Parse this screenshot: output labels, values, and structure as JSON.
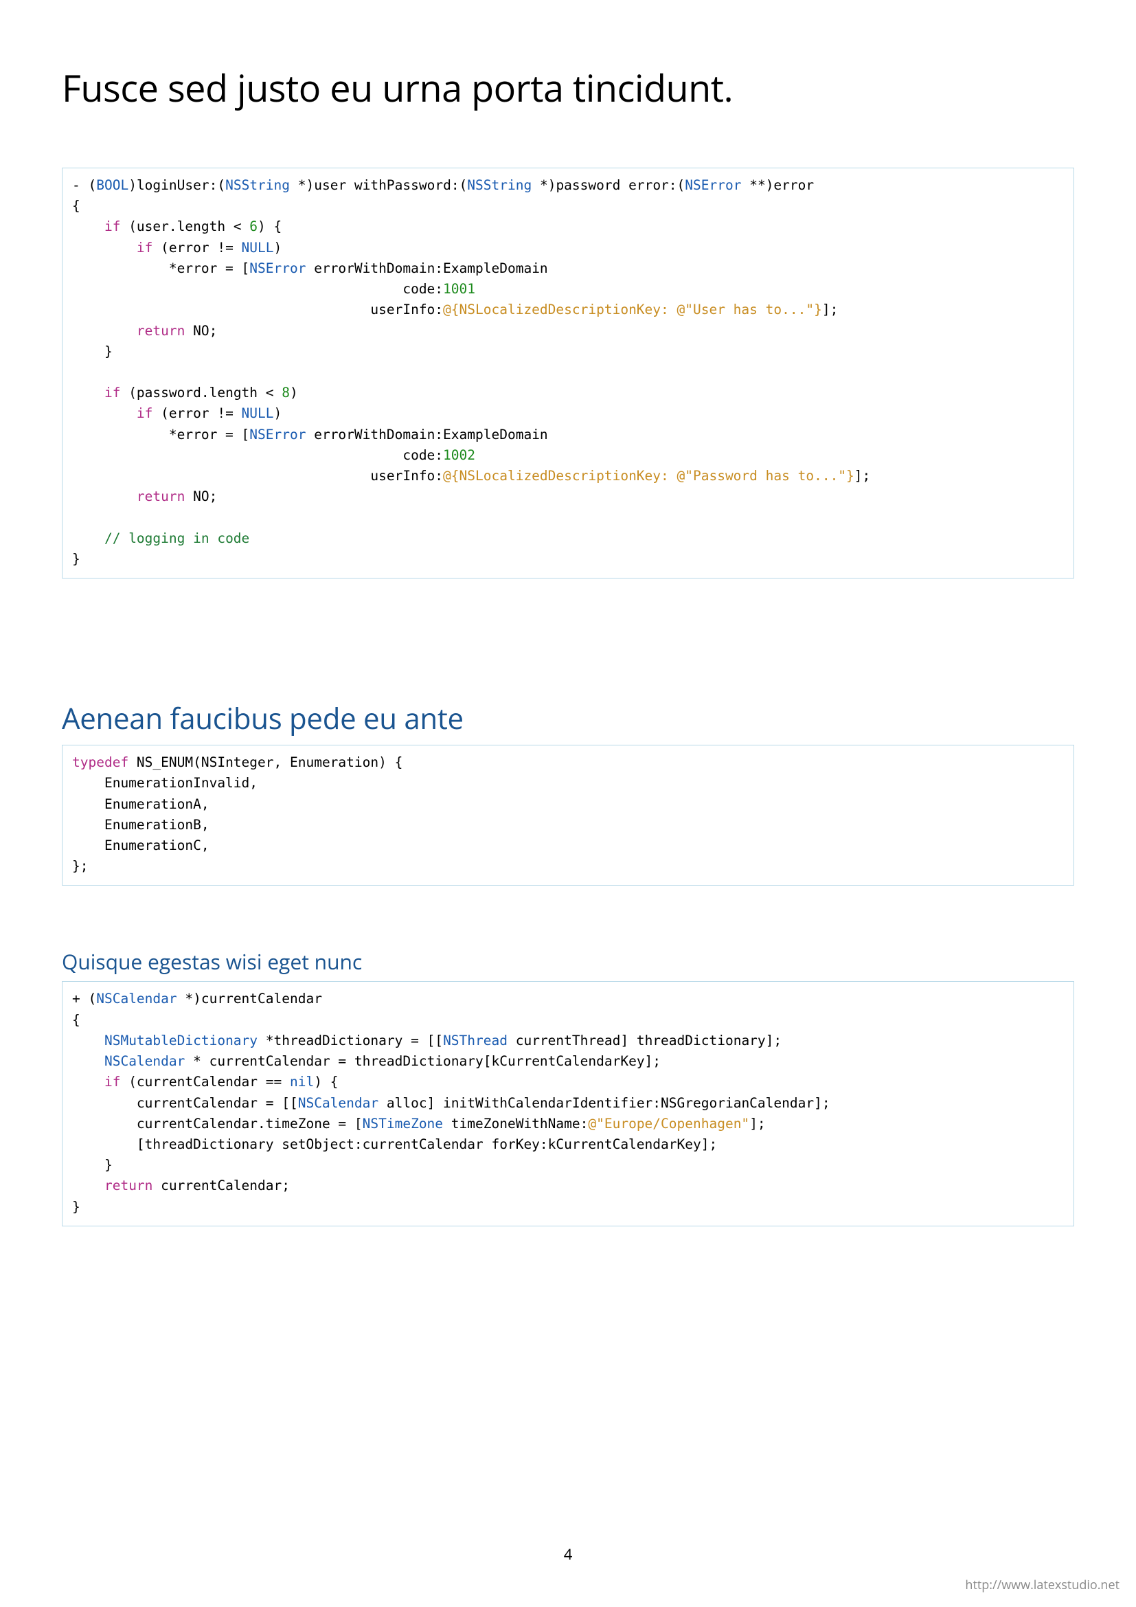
{
  "page_number": "4",
  "footer_url": "http://www.latexstudio.net",
  "heading_main": "Fusce sed justo eu urna porta tincidunt.",
  "heading_section": "Aenean faucibus pede eu ante",
  "heading_subsection": "Quisque egestas wisi eget nunc",
  "code1": {
    "l01a": "- (",
    "l01_bool": "BOOL",
    "l01b": ")loginUser:(",
    "l01_ns1": "NSString",
    "l01c": " *)user withPassword:(",
    "l01_ns2": "NSString",
    "l01d": " *)password error:(",
    "l01_ns3": "NSError",
    "l01e": " **)error",
    "l02": "{",
    "l03a": "    ",
    "l03_if": "if",
    "l03b": " (user.length < ",
    "l03_num": "6",
    "l03c": ") {",
    "l04a": "        ",
    "l04_if": "if",
    "l04b": " (error != ",
    "l04_null": "NULL",
    "l04c": ")",
    "l05a": "            *error = [",
    "l05_nserr": "NSError",
    "l05b": " errorWithDomain:ExampleDomain",
    "l06a": "                                         code:",
    "l06_num": "1001",
    "l07a": "                                     userInfo:",
    "l07_str": "@{NSLocalizedDescriptionKey: @\"User has to...\"}",
    "l07b": "];",
    "l08a": "        ",
    "l08_ret": "return",
    "l08b": " NO;",
    "l09": "    }",
    "blank": "",
    "l11a": "    ",
    "l11_if": "if",
    "l11b": " (password.length < ",
    "l11_num": "8",
    "l11c": ")",
    "l12a": "        ",
    "l12_if": "if",
    "l12b": " (error != ",
    "l12_null": "NULL",
    "l12c": ")",
    "l13a": "            *error = [",
    "l13_nserr": "NSError",
    "l13b": " errorWithDomain:ExampleDomain",
    "l14a": "                                         code:",
    "l14_num": "1002",
    "l15a": "                                     userInfo:",
    "l15_str": "@{NSLocalizedDescriptionKey: @\"Password has to...\"}",
    "l15b": "];",
    "l16a": "        ",
    "l16_ret": "return",
    "l16b": " NO;",
    "l18a": "    ",
    "l18_cm": "// logging in code",
    "l19": "}"
  },
  "code2": {
    "l1a": "",
    "l1_td": "typedef",
    "l1b": " NS_ENUM(NSInteger, Enumeration) {",
    "l2": "    EnumerationInvalid,",
    "l3": "    EnumerationA,",
    "l4": "    EnumerationB,",
    "l5": "    EnumerationC,",
    "l6": "};"
  },
  "code3": {
    "l01a": "+ (",
    "l01_t": "NSCalendar",
    "l01b": " *)currentCalendar",
    "l02": "{",
    "l03a": "    ",
    "l03_t": "NSMutableDictionary",
    "l03b": " *threadDictionary = [[",
    "l03_t2": "NSThread",
    "l03c": " currentThread] threadDictionary];",
    "l04a": "    ",
    "l04_t": "NSCalendar",
    "l04b": " * currentCalendar = threadDictionary[kCurrentCalendarKey];",
    "l05a": "    ",
    "l05_if": "if",
    "l05b": " (currentCalendar == ",
    "l05_nil": "nil",
    "l05c": ") {",
    "l06a": "        currentCalendar = [[",
    "l06_t": "NSCalendar",
    "l06b": " alloc] initWithCalendarIdentifier:NSGregorianCalendar];",
    "l07a": "        currentCalendar.timeZone = [",
    "l07_t": "NSTimeZone",
    "l07b": " timeZoneWithName:",
    "l07_s": "@\"Europe/Copenhagen\"",
    "l07c": "];",
    "l08": "        [threadDictionary setObject:currentCalendar forKey:kCurrentCalendarKey];",
    "l09": "    }",
    "l10a": "    ",
    "l10_ret": "return",
    "l10b": " currentCalendar;",
    "l11": "}"
  }
}
